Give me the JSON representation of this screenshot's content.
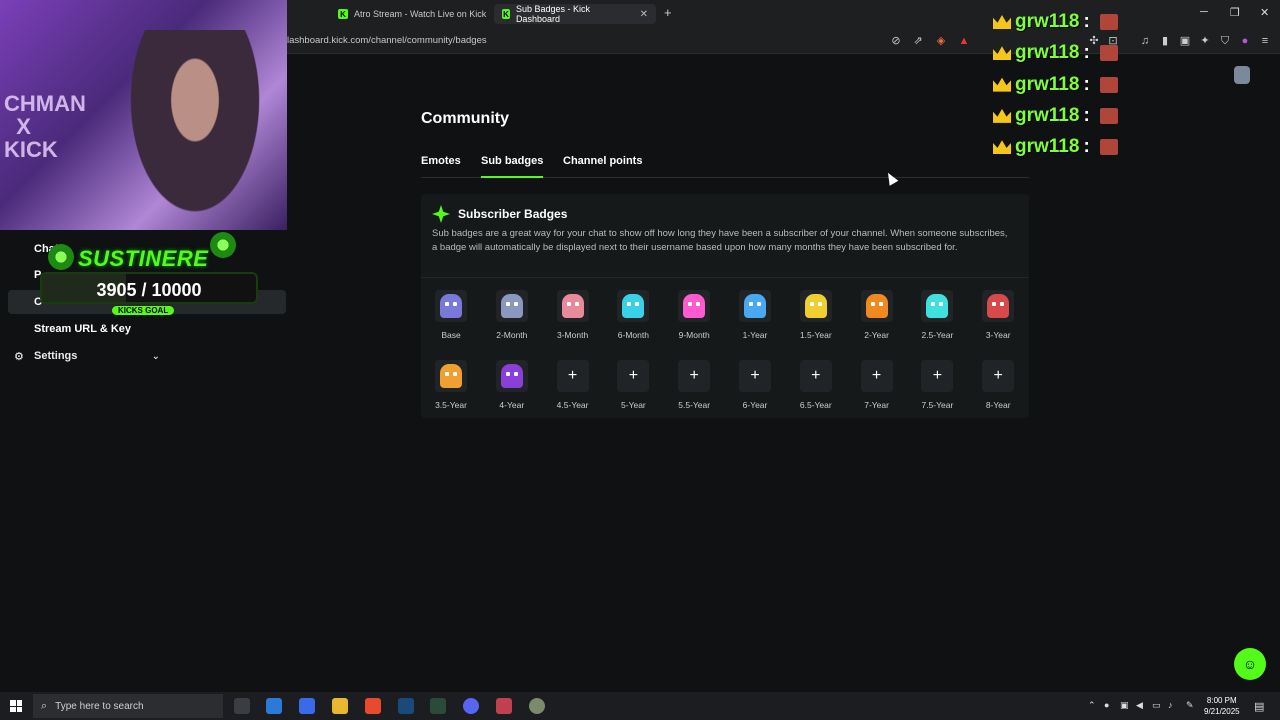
{
  "browser": {
    "tabs": [
      {
        "label": "Atro Stream - Watch Live on Kick"
      },
      {
        "label": "Sub Badges - Kick Dashboard"
      }
    ],
    "url": "lashboard.kick.com/channel/community/badges"
  },
  "overlay": {
    "webcam_text": "CHMAN\nX\nKICK",
    "goal_title": "SUSTINERE",
    "goal_count": "3905  / 10000",
    "goal_current": 3905,
    "goal_target": 10000,
    "goal_label": "KICKS GOAL"
  },
  "sidebar": {
    "items": [
      {
        "label": "Chat"
      },
      {
        "label": "P"
      },
      {
        "label": "C"
      },
      {
        "label": "Stream URL & Key"
      }
    ],
    "settings_label": "Settings"
  },
  "page": {
    "title": "Community",
    "tabs": [
      {
        "label": "Emotes"
      },
      {
        "label": "Sub badges"
      },
      {
        "label": "Channel points"
      }
    ],
    "card": {
      "title": "Subscriber Badges",
      "description": "Sub badges are a great way for your chat to show off how long they have been a subscriber of your channel. When someone subscribes, a badge will automatically be displayed next to their username based upon how many months they have been subscribed for."
    },
    "badges": [
      {
        "label": "Base",
        "type": "image",
        "color": "#7a78d8"
      },
      {
        "label": "2-Month",
        "type": "image",
        "color": "#8a98c0"
      },
      {
        "label": "3-Month",
        "type": "image",
        "color": "#e88a9a"
      },
      {
        "label": "6-Month",
        "type": "image",
        "color": "#3ad0e8"
      },
      {
        "label": "9-Month",
        "type": "image",
        "color": "#ff5ad0"
      },
      {
        "label": "1-Year",
        "type": "image",
        "color": "#4aa8f0"
      },
      {
        "label": "1.5-Year",
        "type": "image",
        "color": "#f0d030"
      },
      {
        "label": "2-Year",
        "type": "image",
        "color": "#f08a20"
      },
      {
        "label": "2.5-Year",
        "type": "image",
        "color": "#40e0e0"
      },
      {
        "label": "3-Year",
        "type": "image",
        "color": "#d84a4a"
      },
      {
        "label": "3.5-Year",
        "type": "image",
        "color": "#f0a030"
      },
      {
        "label": "4-Year",
        "type": "image",
        "color": "#8a40d8"
      },
      {
        "label": "4.5-Year",
        "type": "add"
      },
      {
        "label": "5-Year",
        "type": "add"
      },
      {
        "label": "5.5-Year",
        "type": "add"
      },
      {
        "label": "6-Year",
        "type": "add"
      },
      {
        "label": "6.5-Year",
        "type": "add"
      },
      {
        "label": "7-Year",
        "type": "add"
      },
      {
        "label": "7.5-Year",
        "type": "add"
      },
      {
        "label": "8-Year",
        "type": "add"
      }
    ],
    "add_symbol": "+"
  },
  "chat": {
    "messages": [
      {
        "user": "grw118",
        "sep": ":"
      },
      {
        "user": "grw118",
        "sep": ":"
      },
      {
        "user": "grw118",
        "sep": ":"
      },
      {
        "user": "grw118",
        "sep": ":"
      },
      {
        "user": "grw118",
        "sep": ":"
      }
    ]
  },
  "taskbar": {
    "search_placeholder": "Type here to search",
    "time": "8:00 PM",
    "date": "9/21/2025"
  },
  "colors": {
    "accent": "#53fc18",
    "background": "#0f1112",
    "card": "#16191a"
  }
}
